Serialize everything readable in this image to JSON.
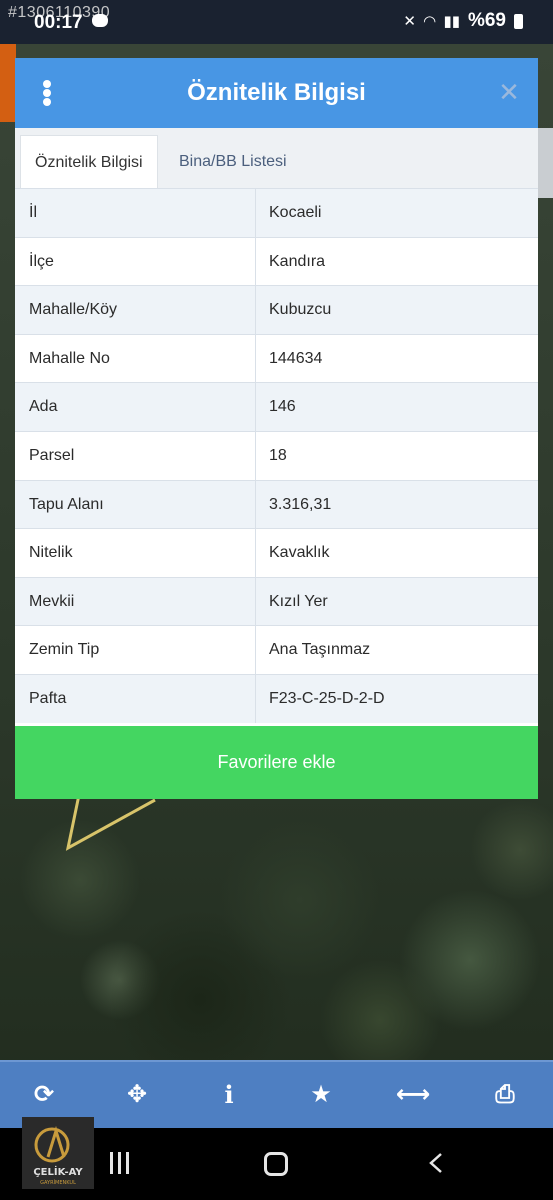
{
  "status_bar": {
    "watermark_id": "#1306110390",
    "time": "00:17",
    "battery": "%69"
  },
  "dialog": {
    "title": "Öznitelik Bilgisi",
    "tabs": [
      {
        "label": "Öznitelik Bilgisi",
        "active": true
      },
      {
        "label": "Bina/BB Listesi",
        "active": false
      }
    ],
    "rows": [
      {
        "key": "İl",
        "value": "Kocaeli"
      },
      {
        "key": "İlçe",
        "value": "Kandıra"
      },
      {
        "key": "Mahalle/Köy",
        "value": "Kubuzcu"
      },
      {
        "key": "Mahalle No",
        "value": "144634"
      },
      {
        "key": "Ada",
        "value": "146"
      },
      {
        "key": "Parsel",
        "value": "18"
      },
      {
        "key": "Tapu Alanı",
        "value": "3.316,31"
      },
      {
        "key": "Nitelik",
        "value": "Kavaklık"
      },
      {
        "key": "Mevkii",
        "value": "Kızıl Yer"
      },
      {
        "key": "Zemin Tip",
        "value": "Ana Taşınmaz"
      },
      {
        "key": "Pafta",
        "value": "F23-C-25-D-2-D"
      }
    ],
    "favorite_button": "Favorilere ekle"
  },
  "toolbar": {
    "buttons": [
      "refresh-icon",
      "locate-icon",
      "info-icon",
      "star-icon",
      "measure-icon",
      "print-icon"
    ]
  },
  "logo": {
    "text": "ÇELİK-AY",
    "subtext": "GAYRİMENKUL"
  },
  "colors": {
    "header_blue": "#4896e4",
    "favorite_green": "#44d661",
    "toolbar_blue": "#4e7fc2"
  }
}
